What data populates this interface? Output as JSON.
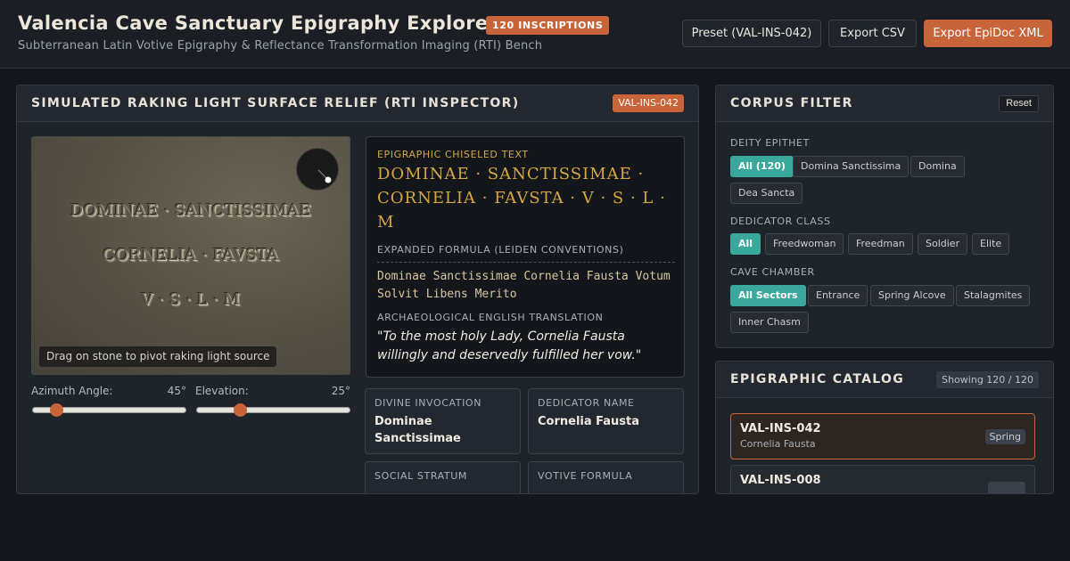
{
  "header": {
    "title": "Valencia Cave Sanctuary Epigraphy Explorer",
    "badge": "120 INSCRIPTIONS",
    "subtitle": "Subterranean Latin Votive Epigraphy & Reflectance Transformation Imaging (RTI) Bench",
    "buttons": {
      "preset": "Preset (VAL-INS-042)",
      "export_csv": "Export CSV",
      "export_epidoc": "Export EpiDoc XML"
    }
  },
  "inspector": {
    "title": "SIMULATED RAKING LIGHT SURFACE RELIEF (RTI INSPECTOR)",
    "id_badge": "VAL-INS-042",
    "stone_lines": [
      "DOMINAE · SANCTISSIMAE",
      "CORNELIA · FAVSTA",
      "V · S · L · M"
    ],
    "hint": "Drag on stone to pivot raking light source",
    "azimuth": {
      "label": "Azimuth Angle:",
      "value": "45°",
      "fraction": 0.15
    },
    "elevation": {
      "label": "Elevation:",
      "value": "25°",
      "fraction": 0.28
    },
    "chiseled_label": "EPIGRAPHIC CHISELED TEXT",
    "chiseled_text": "DOMINAE · SANCTISSIMAE · CORNELIA · FAVSTA · V · S · L · M",
    "expanded_label": "EXPANDED FORMULA (LEIDEN CONVENTIONS)",
    "expanded_text": "Dominae Sanctissimae Cornelia Fausta Votum Solvit Libens Merito",
    "translation_label": "ARCHAEOLOGICAL ENGLISH TRANSLATION",
    "translation_text": "\"To the most holy Lady, Cornelia Fausta willingly and deservedly fulfilled her vow.\"",
    "fields": {
      "divine_label": "DIVINE INVOCATION",
      "divine_value": "Dominae Sanctissimae",
      "dedicator_label": "DEDICATOR NAME",
      "dedicator_value": "Cornelia Fausta",
      "stratum_label": "SOCIAL STRATUM",
      "formula_label": "VOTIVE FORMULA"
    }
  },
  "filter": {
    "title": "CORPUS FILTER",
    "reset": "Reset",
    "deity_label": "DEITY EPITHET",
    "deity_chips": [
      "All (120)",
      "Domina Sanctissima",
      "Domina",
      "Dea Sancta"
    ],
    "dedicator_label": "DEDICATOR CLASS",
    "dedicator_chips": [
      "All",
      "Freedwoman",
      "Freedman",
      "Soldier",
      "Elite"
    ],
    "chamber_label": "CAVE CHAMBER",
    "chamber_chips": [
      "All Sectors",
      "Entrance",
      "Spring Alcove",
      "Stalagmites",
      "Inner Chasm"
    ]
  },
  "catalog": {
    "title": "EPIGRAPHIC CATALOG",
    "showing": "Showing 120 / 120",
    "items": [
      {
        "id": "VAL-INS-042",
        "name": "Cornelia Fausta",
        "tag": "Spring"
      },
      {
        "id": "VAL-INS-008",
        "name": "",
        "tag": ""
      }
    ]
  },
  "colors": {
    "accent": "#c8643a",
    "teal": "#3aa89a",
    "gold": "#d4a843"
  }
}
